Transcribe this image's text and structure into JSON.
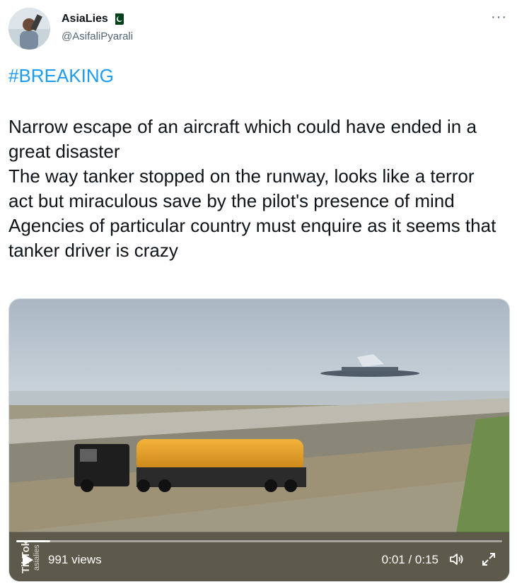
{
  "user": {
    "display_name": "AsiaLies",
    "handle": "@AsifaliPyarali",
    "badge": "pakistan-flag-icon"
  },
  "tweet": {
    "hashtag": "#BREAKING",
    "lines": [
      "Narrow escape of an aircraft which could have ended in a great disaster",
      "The way tanker stopped on the runway, looks like a terror act but miraculous save by the pilot's presence of mind",
      "Agencies of particular country must enquire as it seems that tanker driver is crazy"
    ]
  },
  "video": {
    "views": "991 views",
    "time": "0:01 / 0:15",
    "progress": 0.07,
    "watermark_brand": "TikTok",
    "watermark_user": "asialies"
  },
  "colors": {
    "link": "#1d9bf0",
    "text": "#0f1419",
    "secondary": "#536471"
  }
}
